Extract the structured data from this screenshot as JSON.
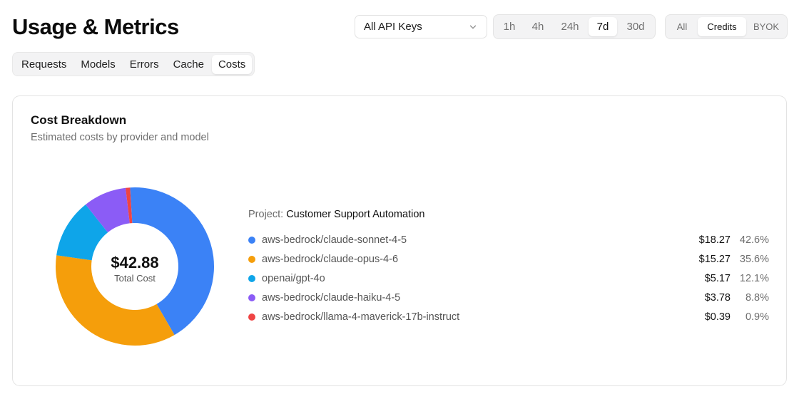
{
  "header": {
    "title": "Usage & Metrics",
    "api_key_select": {
      "value": "All API Keys"
    },
    "time_ranges": [
      {
        "label": "1h",
        "w": 38
      },
      {
        "label": "4h",
        "w": 38
      },
      {
        "label": "24h",
        "w": 48
      },
      {
        "label": "7d",
        "w": 40,
        "active": true
      },
      {
        "label": "30d",
        "w": 48
      }
    ],
    "modes": [
      {
        "label": "All"
      },
      {
        "label": "Credits",
        "active": true
      },
      {
        "label": "BYOK"
      }
    ]
  },
  "tabs": [
    {
      "label": "Requests"
    },
    {
      "label": "Models"
    },
    {
      "label": "Errors"
    },
    {
      "label": "Cache"
    },
    {
      "label": "Costs",
      "active": true
    }
  ],
  "card": {
    "title": "Cost Breakdown",
    "subtitle": "Estimated costs by provider and model",
    "total_value": "$42.88",
    "total_label": "Total Cost",
    "project_label": "Project:",
    "project_name": "Customer Support Automation"
  },
  "chart_data": {
    "type": "pie",
    "categories": [
      "aws-bedrock/claude-sonnet-4-5",
      "aws-bedrock/claude-opus-4-6",
      "openai/gpt-4o",
      "aws-bedrock/claude-haiku-4-5",
      "aws-bedrock/llama-4-maverick-17b-instruct"
    ],
    "values": [
      18.27,
      15.27,
      5.17,
      3.78,
      0.39
    ],
    "cost_labels": [
      "$18.27",
      "$15.27",
      "$5.17",
      "$3.78",
      "$0.39"
    ],
    "percent_labels": [
      "42.6%",
      "35.6%",
      "12.1%",
      "8.8%",
      "0.9%"
    ],
    "colors": [
      "#3b82f6",
      "#f59e0b",
      "#0ea5e9",
      "#8b5cf6",
      "#ef4444"
    ],
    "total": 42.88,
    "donut": true
  }
}
